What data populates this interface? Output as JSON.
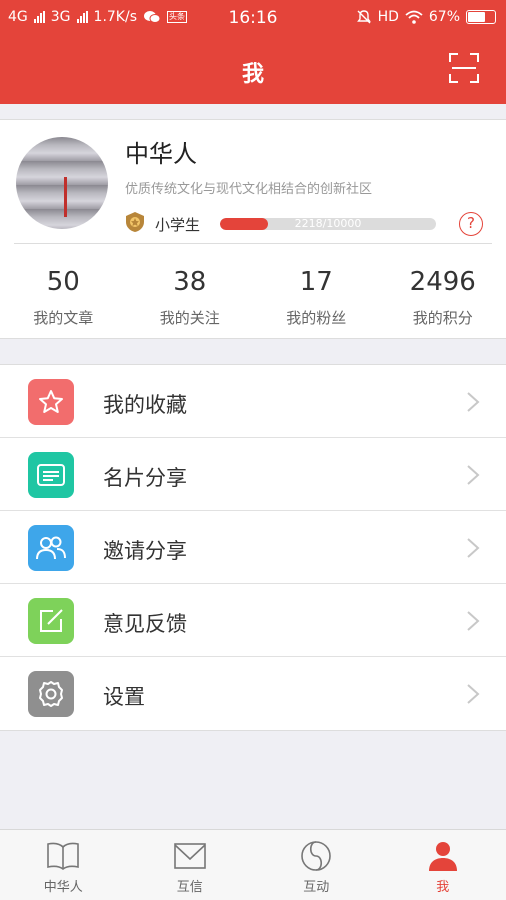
{
  "status_bar": {
    "network1": "4G",
    "network2": "3G",
    "speed": "1.7K/s",
    "time": "16:16",
    "hd": "HD",
    "battery": "67%",
    "battery_level": 0.67,
    "notif_badge": "头条"
  },
  "header": {
    "title": "我",
    "scan_icon": "scan-icon"
  },
  "profile": {
    "name": "中华人",
    "slogan": "优质传统文化与现代文化相结合的创新社区",
    "level_name": "小学生",
    "progress_text": "2218/10000",
    "progress_value": 2218,
    "progress_max": 10000,
    "help": "?"
  },
  "stats": [
    {
      "value": "50",
      "label": "我的文章"
    },
    {
      "value": "38",
      "label": "我的关注"
    },
    {
      "value": "17",
      "label": "我的粉丝"
    },
    {
      "value": "2496",
      "label": "我的积分"
    }
  ],
  "menu": [
    {
      "label": "我的收藏",
      "icon": "star-icon",
      "color": "#f26d6d"
    },
    {
      "label": "名片分享",
      "icon": "card-icon",
      "color": "#1fc6a3"
    },
    {
      "label": "邀请分享",
      "icon": "users-icon",
      "color": "#3ea6ea"
    },
    {
      "label": "意见反馈",
      "icon": "edit-icon",
      "color": "#7ed25a"
    },
    {
      "label": "设置",
      "icon": "gear-icon",
      "color": "#8f8f8f"
    }
  ],
  "tabs": [
    {
      "label": "中华人",
      "icon": "book-icon",
      "active": false
    },
    {
      "label": "互信",
      "icon": "mail-icon",
      "active": false
    },
    {
      "label": "互动",
      "icon": "yinyang-icon",
      "active": false
    },
    {
      "label": "我",
      "icon": "person-icon",
      "active": true
    }
  ],
  "colors": {
    "brand": "#e4443a",
    "background": "#efeff4"
  }
}
